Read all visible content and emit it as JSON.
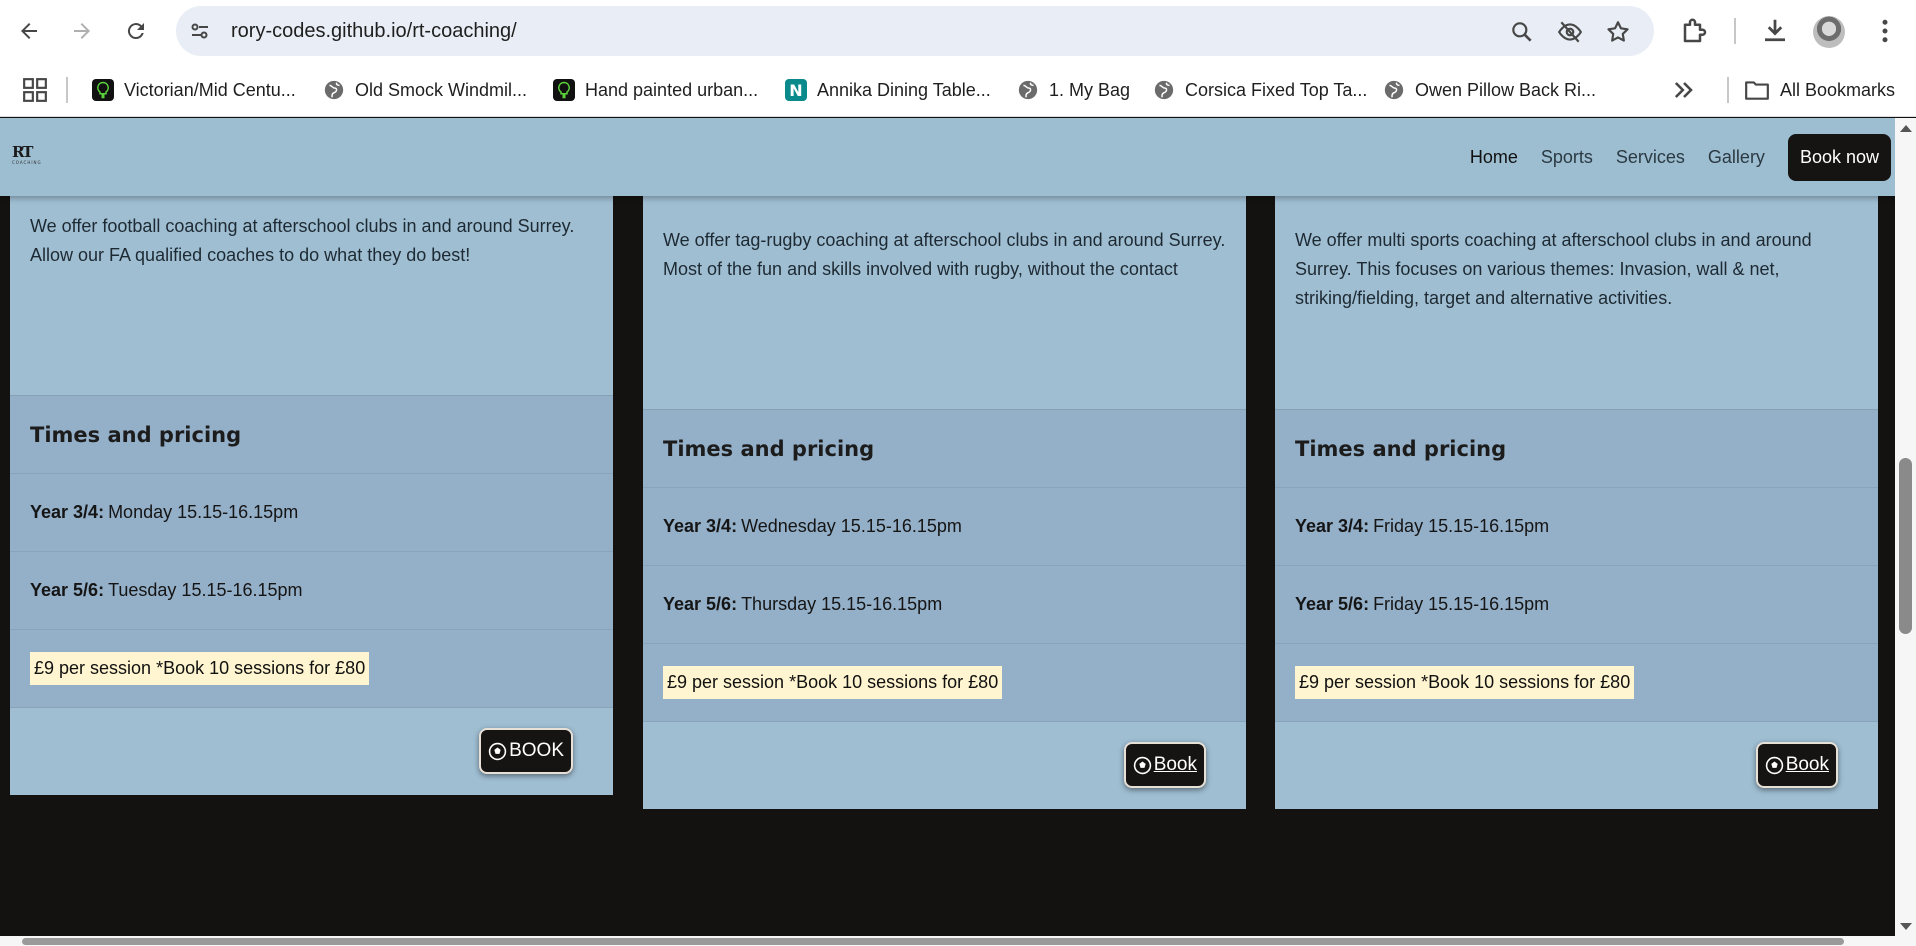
{
  "browser": {
    "url": "rory-codes.github.io/rt-coaching/",
    "bookmarks": [
      {
        "label": "Victorian/Mid Centu...",
        "icon": "tree-icon"
      },
      {
        "label": "Old Smock Windmil...",
        "icon": "globe-icon"
      },
      {
        "label": "Hand painted urban...",
        "icon": "tree-icon"
      },
      {
        "label": "Annika Dining Table...",
        "icon": "n-logo-icon",
        "glyph": "N"
      },
      {
        "label": "1. My Bag",
        "icon": "globe-icon"
      },
      {
        "label": "Corsica Fixed Top Ta...",
        "icon": "globe-icon"
      },
      {
        "label": "Owen Pillow Back Ri...",
        "icon": "globe-icon"
      }
    ],
    "all_bookmarks_label": "All Bookmarks"
  },
  "site": {
    "logo_text": "RT",
    "logo_sub": "COACHING",
    "nav": {
      "home": "Home",
      "sports": "Sports",
      "services": "Services",
      "gallery": "Gallery",
      "book_now": "Book now"
    },
    "cards": [
      {
        "description": "We offer football coaching at afterschool clubs in and around Surrey. Allow our FA qualified coaches to do what they do best!",
        "pricing_title": "Times and pricing",
        "row1_label": "Year 3/4:",
        "row1_value": " Monday 15.15-16.15pm",
        "row2_label": "Year 5/6:",
        "row2_value": " Tuesday 15.15-16.15pm",
        "price": "£9 per session *Book 10 sessions for £80",
        "book_label": "BOOK"
      },
      {
        "description": "We offer tag-rugby coaching at afterschool clubs in and around Surrey. Most of the fun and skills involved with rugby, without the contact",
        "pricing_title": "Times and pricing",
        "row1_label": "Year 3/4:",
        "row1_value": "Wednesday 15.15-16.15pm",
        "row2_label": "Year 5/6:",
        "row2_value": "Thursday 15.15-16.15pm",
        "price": "£9 per session *Book 10 sessions for £80",
        "book_label": "Book"
      },
      {
        "description": "We offer multi sports coaching at afterschool clubs in and around Surrey. This focuses on various themes: Invasion, wall & net, striking/fielding, target and alternative activities.",
        "pricing_title": "Times and pricing",
        "row1_label": "Year 3/4:",
        "row1_value": " Friday 15.15-16.15pm",
        "row2_label": "Year 5/6:",
        "row2_value": "Friday 15.15-16.15pm",
        "price": "£9 per session *Book 10 sessions for £80",
        "book_label": "Book"
      }
    ]
  },
  "colors": {
    "header_bg": "#9dbdd0",
    "card_bg": "#9fbed2",
    "pricing_bg": "#94afc8",
    "page_bg": "#141210",
    "price_badge_bg": "#fff5d0",
    "button_bg": "#161413"
  }
}
